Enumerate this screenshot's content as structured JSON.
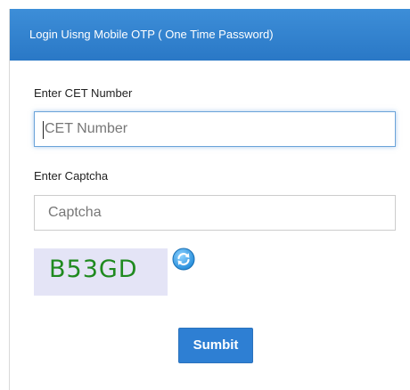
{
  "header": {
    "title": "Login Uisng Mobile OTP ( One Time Password)"
  },
  "cet_field": {
    "label": "Enter CET Number",
    "placeholder": "CET Number",
    "value": ""
  },
  "captcha_field": {
    "label": "Enter Captcha",
    "placeholder": "Captcha",
    "value": ""
  },
  "captcha_image": {
    "text": "B53GD"
  },
  "refresh_icon": "refresh-icon",
  "submit": {
    "label": "Sumbit"
  },
  "colors": {
    "header": "#2f80cf",
    "submit": "#2e7fd3",
    "captcha_bg": "#e4e4f6",
    "captcha_text": "#1f8a1f"
  }
}
